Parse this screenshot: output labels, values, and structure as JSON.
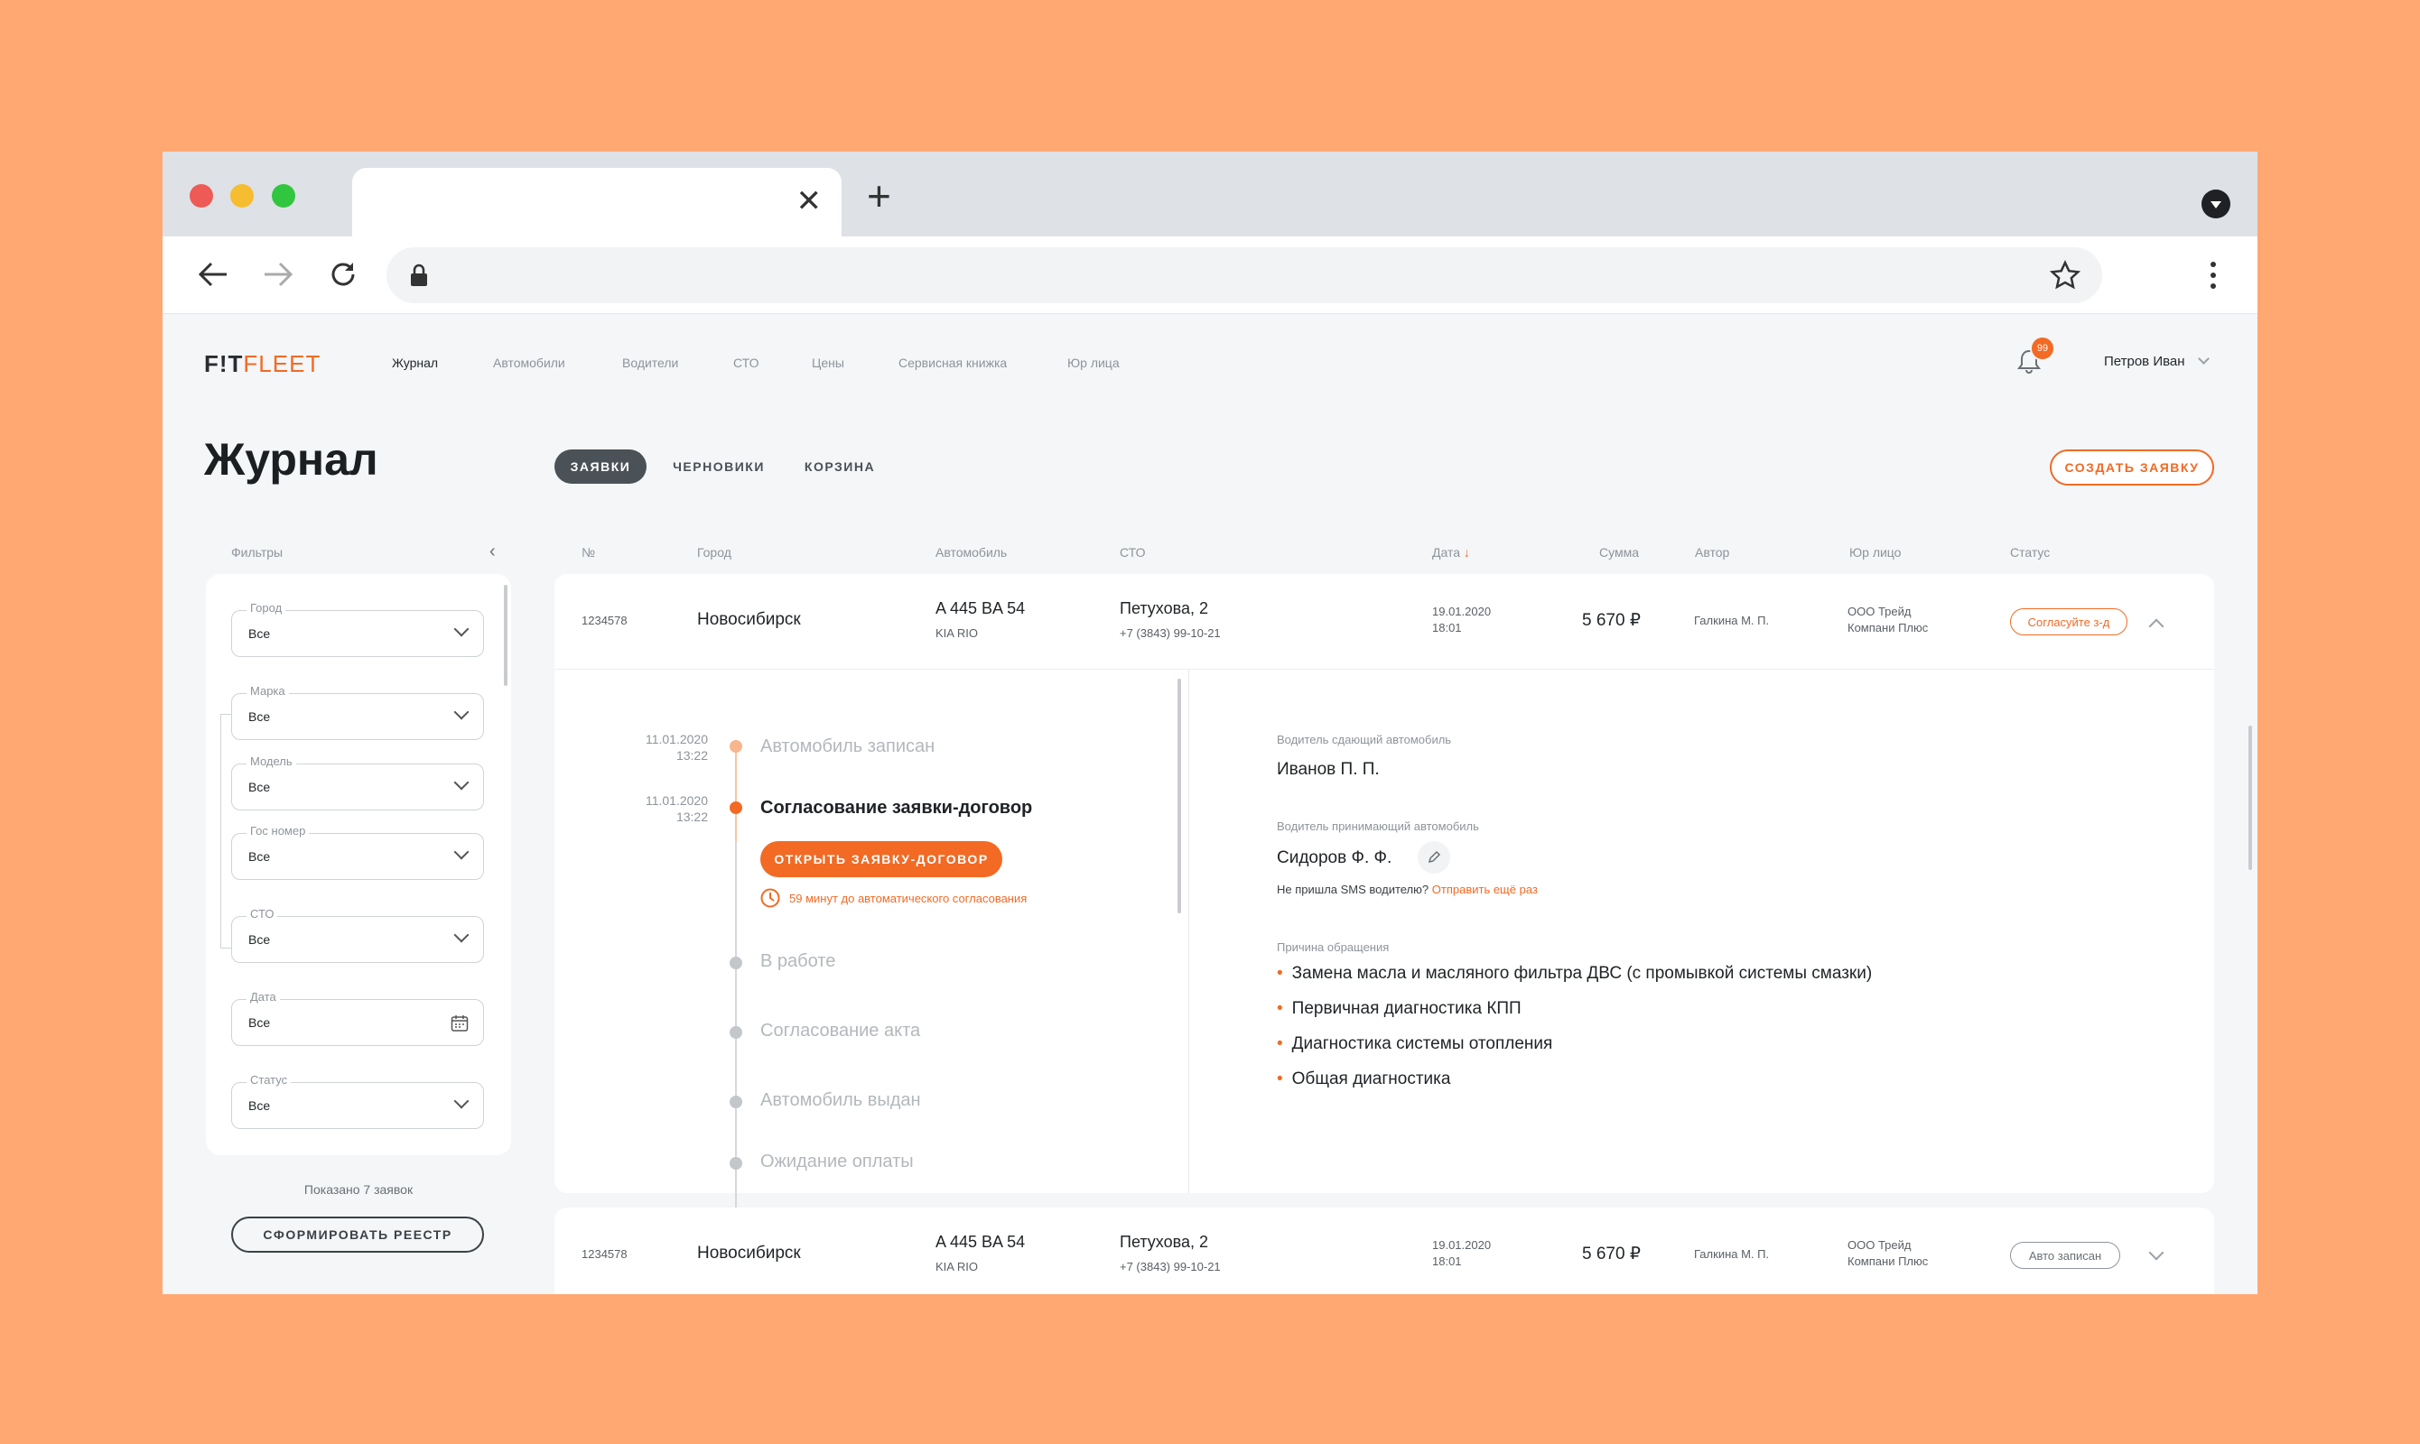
{
  "browser": {
    "tab_close": "✕",
    "new_tab": "+"
  },
  "app": {
    "logo_part1": "F!T",
    "logo_part2": "FLEET",
    "nav": [
      {
        "label": "Журнал",
        "active": true
      },
      {
        "label": "Автомобили"
      },
      {
        "label": "Водители"
      },
      {
        "label": "СТО"
      },
      {
        "label": "Цены"
      },
      {
        "label": "Сервисная книжка"
      },
      {
        "label": "Юр лица"
      }
    ],
    "notifications_count": "99",
    "user_name": "Петров Иван"
  },
  "page": {
    "title": "Журнал",
    "tabs": [
      {
        "label": "ЗАЯВКИ",
        "active": true
      },
      {
        "label": "ЧЕРНОВИКИ"
      },
      {
        "label": "КОРЗИНА"
      }
    ],
    "create_button": "СОЗДАТЬ ЗАЯВКУ"
  },
  "filters": {
    "title": "Фильтры",
    "fields": [
      {
        "label": "Город",
        "value": "Все"
      },
      {
        "label": "Марка",
        "value": "Все"
      },
      {
        "label": "Модель",
        "value": "Все"
      },
      {
        "label": "Гос номер",
        "value": "Все"
      },
      {
        "label": "СТО",
        "value": "Все"
      },
      {
        "label": "Дата",
        "value": "Все"
      },
      {
        "label": "Статус",
        "value": "Все"
      }
    ],
    "shown_text": "Показано  7 заявок",
    "registry_button": "СФОРМИРОВАТЬ РЕЕСТР"
  },
  "table": {
    "headers": [
      "№",
      "Город",
      "Автомобиль",
      "СТО",
      "Дата",
      "Сумма",
      "Автор",
      "Юр лицо",
      "Статус"
    ],
    "rows": [
      {
        "number": "1234578",
        "city": "Новосибирск",
        "car_plate": "A 445 BA 54",
        "car_model": "KIA RIO",
        "sto_address": "Петухова, 2",
        "sto_phone": "+7 (3843) 99-10-21",
        "date": "19.01.2020",
        "time": "18:01",
        "sum": "5 670 ₽",
        "author": "Галкина М. П.",
        "legal_line1": "ООО Трейд",
        "legal_line2": "Компани Плюс",
        "status": "Согласуйте з-д",
        "status_color": "#f26a24"
      },
      {
        "number": "1234578",
        "city": "Новосибирск",
        "car_plate": "A 445 BA 54",
        "car_model": "KIA RIO",
        "sto_address": "Петухова, 2",
        "sto_phone": "+7 (3843) 99-10-21",
        "date": "19.01.2020",
        "time": "18:01",
        "sum": "5 670 ₽",
        "author": "Галкина М. П.",
        "legal_line1": "ООО Трейд",
        "legal_line2": "Компани Плюс",
        "status": "Авто записан",
        "status_color": "#8e949a"
      }
    ]
  },
  "details": {
    "timeline": [
      {
        "date": "11.01.2020",
        "time": "13:22",
        "title": "Автомобиль записан",
        "state": "done"
      },
      {
        "date": "11.01.2020",
        "time": "13:22",
        "title": "Согласование заявки-договор",
        "state": "current"
      },
      {
        "title": "В работе",
        "state": "pending"
      },
      {
        "title": "Согласование акта",
        "state": "pending"
      },
      {
        "title": "Автомобиль выдан",
        "state": "pending"
      },
      {
        "title": "Ожидание оплаты",
        "state": "pending"
      }
    ],
    "open_contract_button": "ОТКРЫТЬ ЗАЯВКУ-ДОГОВОР",
    "auto_approve_text": "59 минут до автоматического согласования",
    "driver_out_label": "Водитель сдающий автомобиль",
    "driver_out": "Иванов П. П.",
    "driver_in_label": "Водитель принимающий автомобиль",
    "driver_in": "Сидоров Ф. Ф.",
    "sms_text": "Не пришла SMS водителю?",
    "sms_link": "Отправить ещё раз",
    "reason_label": "Причина обращения",
    "reasons": [
      "Замена масла и масляного фильтра ДВС (с промывкой системы смазки)",
      "Первичная диагностика КПП",
      "Диагностика системы отопления",
      "Общая диагностика"
    ]
  },
  "colors": {
    "accent": "#f26a24",
    "background": "#FFA872",
    "page_bg": "#f4f6f8"
  }
}
